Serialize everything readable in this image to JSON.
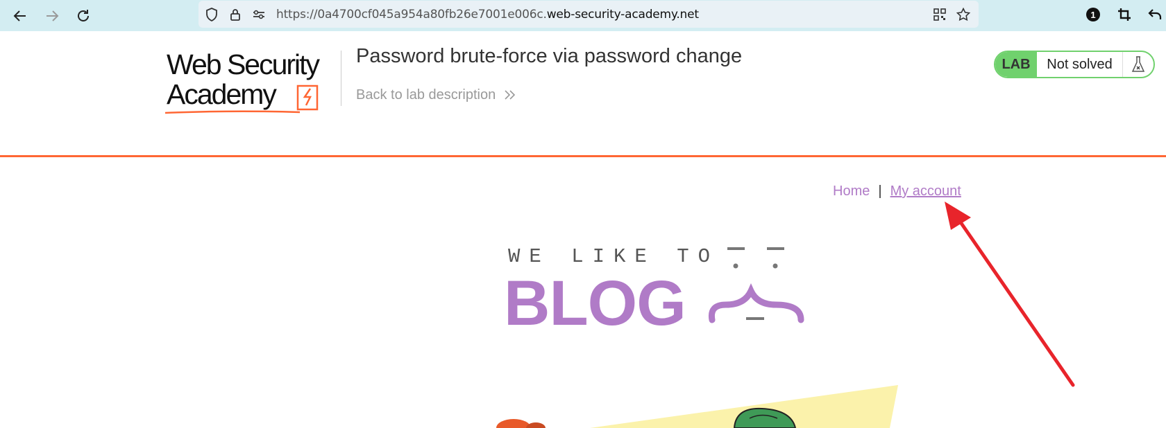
{
  "browser": {
    "url_prefix": "https://0a4700cf045a954a80fb26e7001e006c.",
    "url_domain": "web-security-academy.net",
    "badge_count": "1"
  },
  "header": {
    "logo_line1": "Web Security",
    "logo_line2": "Academy",
    "lab_title": "Password brute-force via password change",
    "back_link": "Back to lab description",
    "badge_label": "LAB",
    "badge_status": "Not solved"
  },
  "nav": {
    "home": "Home",
    "separator": "|",
    "my_account": "My account"
  },
  "banner": {
    "small_text": "WE LIKE TO",
    "big_text": "BLOG"
  },
  "colors": {
    "accent_orange": "#ff6633",
    "purple_link": "#b07bc7",
    "lab_green": "#70d16d",
    "annotation_red": "#e8242b"
  }
}
